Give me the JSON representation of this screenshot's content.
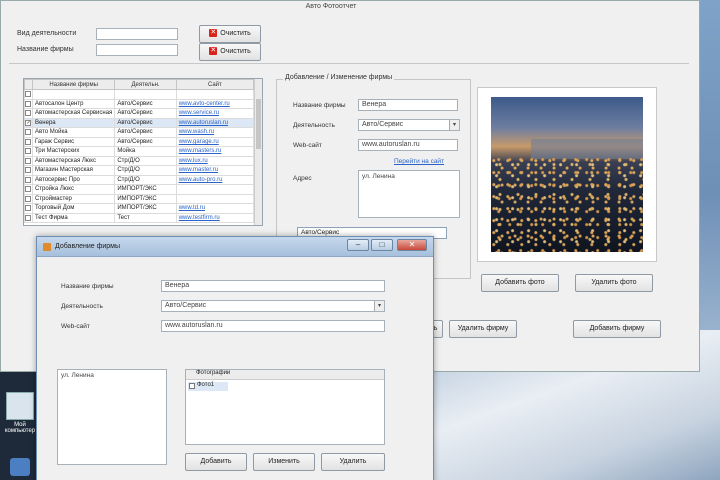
{
  "main_window": {
    "title": "Авто Фотоотчет",
    "top_form": {
      "field1_label": "Вид деятельности",
      "field1_value": "",
      "field2_label": "Название фирмы",
      "field2_value": "",
      "btn_top_label": "Очистить",
      "btn_bottom_label": "Очистить"
    },
    "table": {
      "headers": [
        "",
        "Название фирмы",
        "Деятельн.",
        "Сайт"
      ],
      "rows": [
        {
          "checked": false,
          "name": "",
          "activity": "",
          "site": ""
        },
        {
          "checked": false,
          "name": "Автосалон Центр",
          "activity": "Авто/Сервис",
          "site": "www.avto-center.ru"
        },
        {
          "checked": false,
          "name": "Автомастерская Сервисная",
          "activity": "Авто/Сервис",
          "site": "www.service.ru"
        },
        {
          "checked": true,
          "name": "Венера",
          "activity": "Авто/Сервис",
          "site": "www.autoruslan.ru"
        },
        {
          "checked": false,
          "name": "Авто Мойка",
          "activity": "Авто/Сервис",
          "site": "www.wash.ru"
        },
        {
          "checked": false,
          "name": "Гараж Сервис",
          "activity": "Авто/Сервис",
          "site": "www.garage.ru"
        },
        {
          "checked": false,
          "name": "Три Мастерских",
          "activity": "Мойка",
          "site": "www.masters.ru"
        },
        {
          "checked": false,
          "name": "Автомастерская Люкс",
          "activity": "Стр/Д/О",
          "site": "www.lux.ru"
        },
        {
          "checked": false,
          "name": "Магазин Мастерская",
          "activity": "Стр/Д/О",
          "site": "www.master.ru"
        },
        {
          "checked": false,
          "name": "Автосервис Про",
          "activity": "Стр/Д/О",
          "site": "www.auto-pro.ru"
        },
        {
          "checked": false,
          "name": "Стройка Люкс",
          "activity": "ИМПОРТ/ЭКС",
          "site": ""
        },
        {
          "checked": false,
          "name": "Строймастер",
          "activity": "ИМПОРТ/ЭКС",
          "site": ""
        },
        {
          "checked": false,
          "name": "Торговый Дом",
          "activity": "ИМПОРТ/ЭКС",
          "site": "www.td.ru"
        },
        {
          "checked": false,
          "name": "Тест Фирма",
          "activity": "Тест",
          "site": "www.testfirm.ru"
        }
      ]
    },
    "groupbox": {
      "title": "Добавление / Изменение фирмы",
      "name_label": "Название фирмы",
      "name_value": "Венера",
      "activity_label": "Деятельность",
      "activity_value": "Авто/Сервис",
      "site_label": "Web-сайт",
      "site_value": "www.autoruslan.ru",
      "link_label": "Перейти на сайт",
      "notes_label": "Адрес",
      "notes_value": "ул. Ленина"
    },
    "photo_buttons": {
      "add": "Добавить фото",
      "delete": "Удалить фото"
    },
    "bottom_buttons": {
      "save": "Сохранить",
      "delete_firm": "Удалить фирму",
      "add_firm": "Добавить фирму"
    },
    "dropdown_overlay": "Авто/Сервис"
  },
  "dialog": {
    "title": "Добавление фирмы",
    "name_label": "Название фирмы",
    "name_value": "Венера",
    "activity_label": "Деятельность",
    "activity_value": "Авто/Сервис",
    "site_label": "Web-сайт",
    "site_value": "www.autoruslan.ru",
    "address_value": "ул. Ленина",
    "list_header": "Фотографии",
    "list_item": "Фото1",
    "buttons": {
      "add": "Добавить",
      "edit": "Изменить",
      "delete": "Удалить"
    }
  },
  "desktop": {
    "icon_label": "Мой компьютер"
  }
}
